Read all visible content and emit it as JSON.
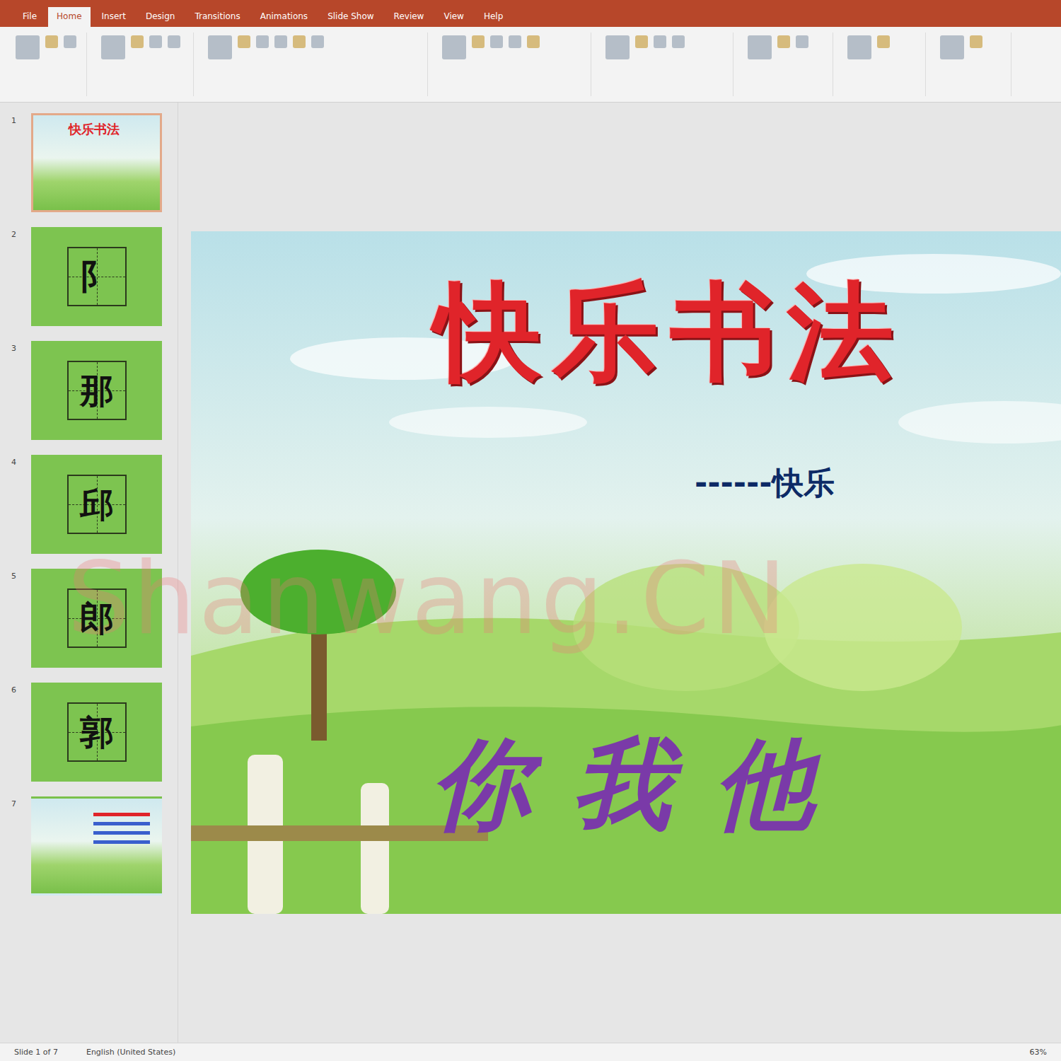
{
  "ribbon": {
    "tabs": [
      {
        "label": "File",
        "selected": false
      },
      {
        "label": "Home",
        "selected": true
      },
      {
        "label": "Insert",
        "selected": false
      },
      {
        "label": "Design",
        "selected": false
      },
      {
        "label": "Transitions",
        "selected": false
      },
      {
        "label": "Animations",
        "selected": false
      },
      {
        "label": "Slide Show",
        "selected": false
      },
      {
        "label": "Review",
        "selected": false
      },
      {
        "label": "View",
        "selected": false
      },
      {
        "label": "Help",
        "selected": false
      }
    ]
  },
  "slides": [
    {
      "number": "1",
      "kind": "title",
      "character": "",
      "selected": true
    },
    {
      "number": "2",
      "kind": "character",
      "character": "阝",
      "selected": false
    },
    {
      "number": "3",
      "kind": "character",
      "character": "那",
      "selected": false
    },
    {
      "number": "4",
      "kind": "character",
      "character": "邱",
      "selected": false
    },
    {
      "number": "5",
      "kind": "character",
      "character": "郎",
      "selected": false
    },
    {
      "number": "6",
      "kind": "character",
      "character": "郭",
      "selected": false
    },
    {
      "number": "7",
      "kind": "summary",
      "character": "",
      "selected": false
    }
  ],
  "slide": {
    "title": "快乐书法",
    "subtitle": "------快乐",
    "footer": "你我他"
  },
  "watermark": "Shanwang.CN",
  "status_bar": {
    "left": "Slide 1 of 7",
    "language": "English (United States)",
    "zoom": "63%"
  }
}
